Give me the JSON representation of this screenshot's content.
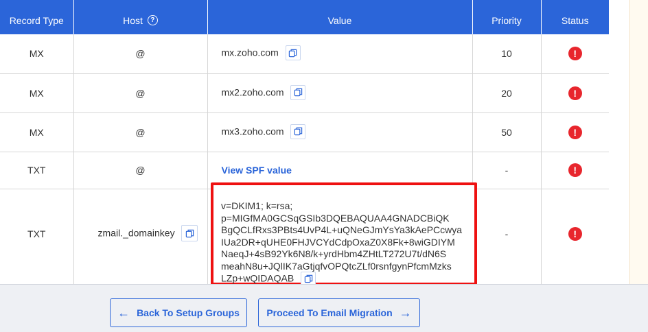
{
  "table": {
    "headers": {
      "record_type": "Record Type",
      "host": "Host",
      "value": "Value",
      "priority": "Priority",
      "status": "Status"
    },
    "rows": [
      {
        "type": "MX",
        "host": "@",
        "value": "mx.zoho.com",
        "priority": "10"
      },
      {
        "type": "MX",
        "host": "@",
        "value": "mx2.zoho.com",
        "priority": "20"
      },
      {
        "type": "MX",
        "host": "@",
        "value": "mx3.zoho.com",
        "priority": "50"
      },
      {
        "type": "TXT",
        "host": "@",
        "value_link": "View SPF value",
        "priority": "-"
      },
      {
        "type": "TXT",
        "host": "zmail._domainkey",
        "value_lines": [
          "v=DKIM1; k=rsa;",
          "p=MIGfMA0GCSqGSIb3DQEBAQUAA4GNADCBiQK",
          "BgQCLfRxs3PBts4UvP4L+uQNeGJmYsYa3kAePCcwya",
          "IUa2DR+qUHE0FHJVCYdCdpOxaZ0X8Fk+8wiGDIYM",
          "NaeqJ+4sB92Yk6N8/k+yrdHbm4ZHtLT272U7t/dN6S",
          "meahN8u+JQlIK7aGtjqfvOPQtcZLf0rsnfgynPfcmMzks",
          "LZp+wQIDAQAB"
        ],
        "priority": "-"
      }
    ],
    "status_symbol": "!"
  },
  "footer": {
    "back_label": "Back To Setup Groups",
    "proceed_label": "Proceed To Email Migration"
  },
  "icons": {
    "copy": "copy-icon",
    "help": "help-circle-icon",
    "status_error": "error-circle-icon",
    "arrow_left": "arrow-left-icon",
    "arrow_right": "arrow-right-icon"
  },
  "colors": {
    "header_bg": "#2b65d9",
    "link": "#2b65d9",
    "error": "#e8262d",
    "highlight_border": "#ee1111"
  }
}
